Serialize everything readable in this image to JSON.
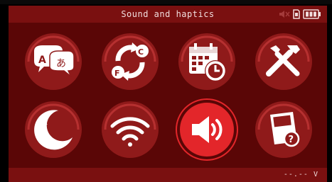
{
  "header": {
    "title": "Sound and haptics"
  },
  "menu": {
    "items": [
      {
        "name": "language",
        "icon": "language-icon",
        "selected": false
      },
      {
        "name": "units",
        "icon": "unit-conversion-icon",
        "selected": false
      },
      {
        "name": "date-time",
        "icon": "calendar-clock-icon",
        "selected": false
      },
      {
        "name": "tools",
        "icon": "tools-icon",
        "selected": false
      },
      {
        "name": "night-mode",
        "icon": "moon-icon",
        "selected": false
      },
      {
        "name": "wifi",
        "icon": "wifi-icon",
        "selected": false
      },
      {
        "name": "sound",
        "icon": "speaker-icon",
        "selected": true
      },
      {
        "name": "about",
        "icon": "device-help-icon",
        "selected": false
      }
    ]
  },
  "footer": {
    "voltage": "--.-- V"
  },
  "colors": {
    "bar": "#7a1010",
    "background": "#5a0606",
    "tile": "#8f1a1a",
    "tile_selected": "#e3262a",
    "icon": "#ffffff"
  }
}
